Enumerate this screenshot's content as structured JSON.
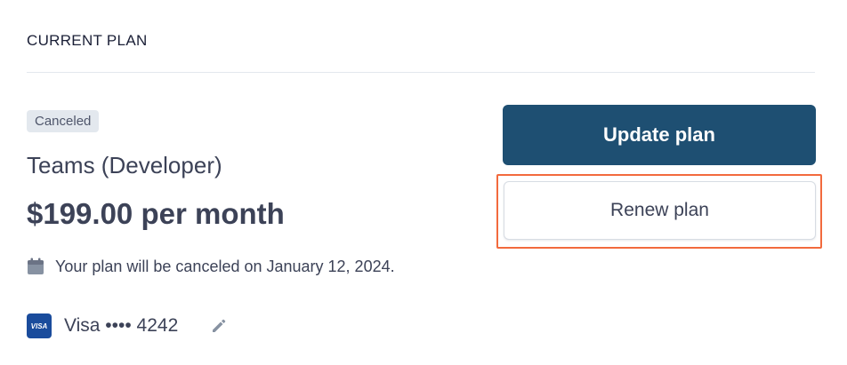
{
  "section": {
    "title": "CURRENT PLAN"
  },
  "plan": {
    "status_badge": "Canceled",
    "name": "Teams (Developer)",
    "price": "$199.00 per month",
    "cancel_note": "Your plan will be canceled on January 12, 2024."
  },
  "payment": {
    "brand_label": "VISA",
    "card_text": "Visa •••• 4242",
    "icons": [
      "calendar-icon",
      "visa-card-icon",
      "pencil-icon"
    ]
  },
  "actions": {
    "update_label": "Update plan",
    "renew_label": "Renew plan"
  },
  "colors": {
    "primary_button": "#1e4f72",
    "highlight": "#f26a3d",
    "badge_bg": "#e3e8ee",
    "text": "#3c4257"
  }
}
